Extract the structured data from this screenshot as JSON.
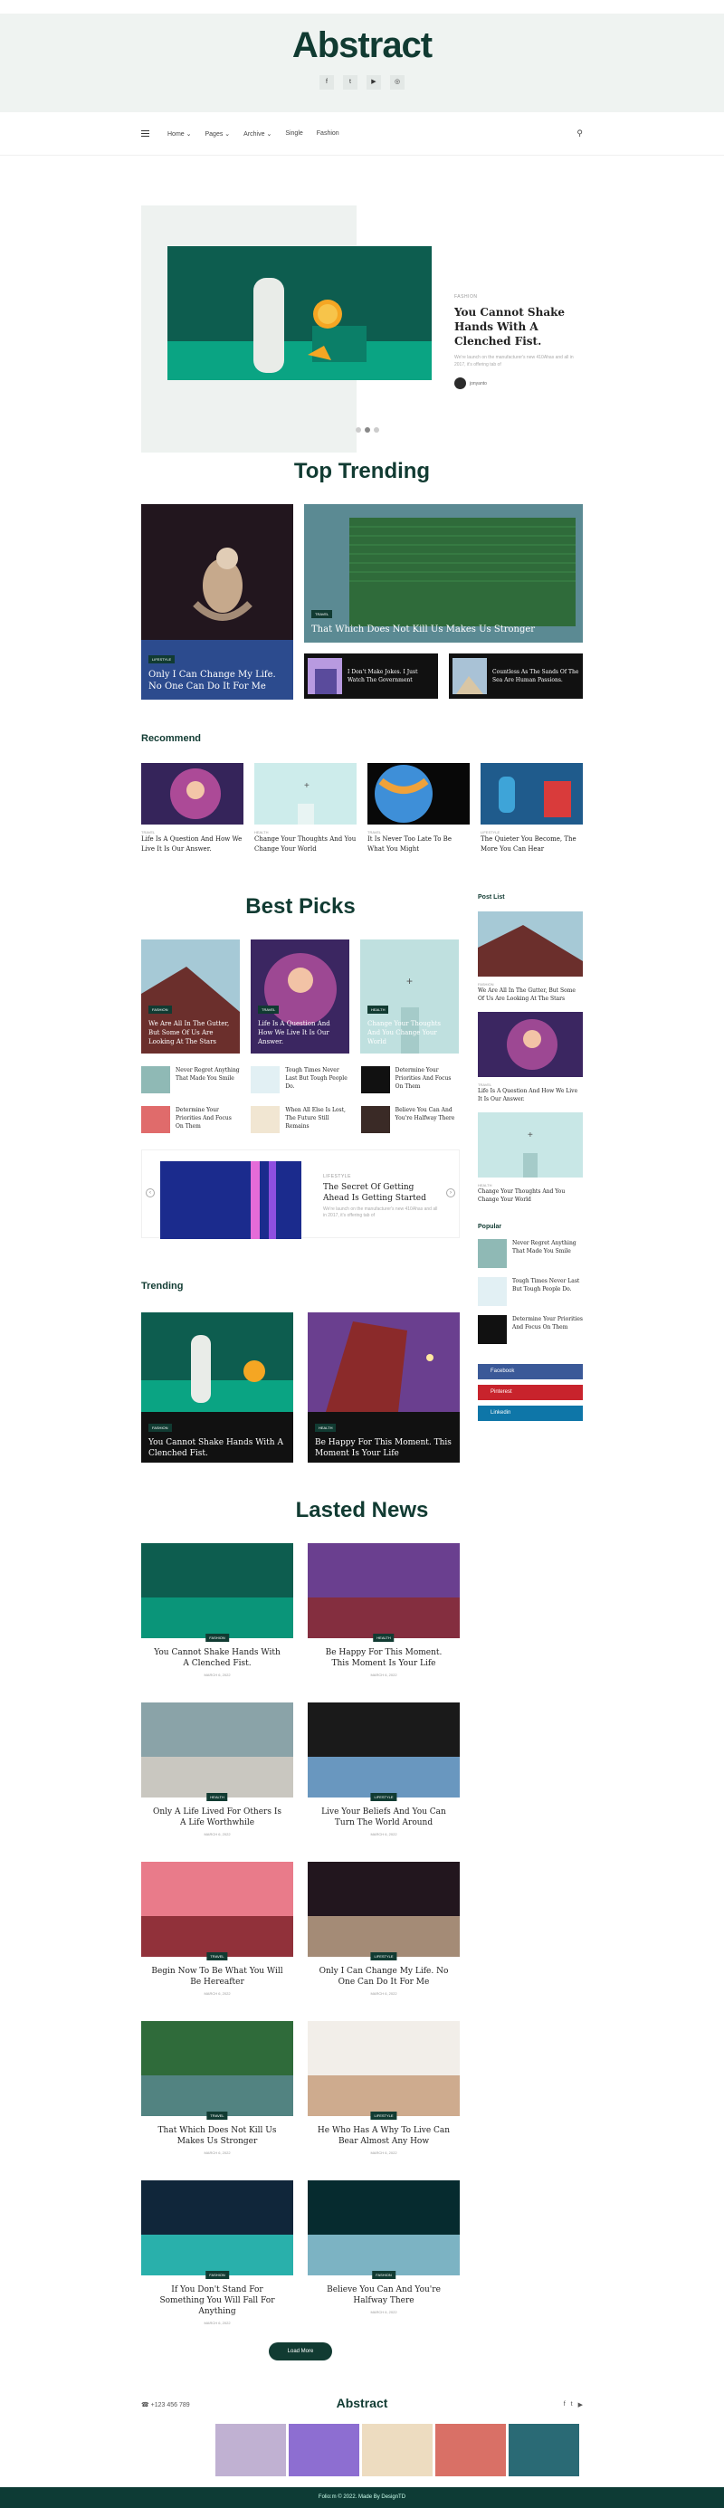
{
  "header": {
    "logo": "Abstract",
    "social": [
      "f",
      "t",
      "▶",
      "◎"
    ]
  },
  "nav": {
    "items": [
      "Home ⌄",
      "Pages ⌄",
      "Archive ⌄",
      "Single",
      "Fashion"
    ]
  },
  "hero": {
    "category": "FASHION",
    "title": "You Cannot Shake Hands With A Clenched Fist.",
    "excerpt": "We're launch on the manufacturer's new 410Ahas and all in 2017, it's offering tab of",
    "author": "jonyanto"
  },
  "trending": {
    "title": "Top Trending",
    "big1": {
      "badge": "LIFESTYLE",
      "title": "Only I Can Change My Life. No One Can Do It For Me"
    },
    "big2": {
      "badge": "TRAVEL",
      "title": "That Which Does Not Kill Us Makes Us Stronger"
    },
    "small": [
      {
        "title": "I Don't Make Jokes. I Just Watch The Government"
      },
      {
        "title": "Countless As The Sands Of The Sea Are Human Passions."
      }
    ]
  },
  "recommend": {
    "title": "Recommend",
    "items": [
      {
        "cat": "TRAVEL",
        "title": "Life Is A Question And How We Live It Is Our Answer."
      },
      {
        "cat": "HEALTH",
        "title": "Change Your Thoughts And You Change Your World"
      },
      {
        "cat": "TRAVEL",
        "title": "It Is Never Too Late To Be What You Might"
      },
      {
        "cat": "LIFESTYLE",
        "title": "The Quieter You Become, The More You Can Hear"
      }
    ]
  },
  "bestpicks": {
    "title": "Best Picks",
    "cards": [
      {
        "badge": "FASHION",
        "title": "We Are All In The Gutter, But Some Of Us Are Looking At The Stars"
      },
      {
        "badge": "TRAVEL",
        "title": "Life Is A Question And How We Live It Is Our Answer."
      },
      {
        "badge": "HEALTH",
        "title": "Change Your Thoughts And You Change Your World"
      }
    ],
    "list": [
      "Never Regret Anything That Made You Smile",
      "Tough Times Never Last But Tough People Do.",
      "Determine Your Priorities And Focus On Them",
      "Determine Your Priorities And Focus On Them",
      "When All Else Is Lost, The Future Still Remains",
      "Believe You Can And You're Halfway There"
    ],
    "slider": {
      "cat": "LIFESTYLE",
      "title": "The Secret Of Getting Ahead Is Getting Started",
      "excerpt": "We're launch on the manufacturer's new 410Ahas and all in 2017, it's offering tab of"
    }
  },
  "sidebar": {
    "post_list": "Post List",
    "posts": [
      {
        "cat": "FASHION",
        "title": "We Are All In The Gutter, But Some Of Us Are Looking At The Stars"
      },
      {
        "cat": "TRAVEL",
        "title": "Life Is A Question And How We Live It Is Our Answer."
      },
      {
        "cat": "HEALTH",
        "title": "Change Your Thoughts And You Change Your World"
      }
    ],
    "popular": "Popular",
    "pop_items": [
      "Never Regret Anything That Made You Smile",
      "Tough Times Never Last But Tough People Do.",
      "Determine Your Priorities And Focus On Them"
    ],
    "share": [
      "Facebook",
      "Pinterest",
      "Linkedin"
    ]
  },
  "trending2": {
    "title": "Trending",
    "cards": [
      {
        "badge": "FASHION",
        "title": "You Cannot Shake Hands With A Clenched Fist.",
        "date": "MARCH 6, 2022"
      },
      {
        "badge": "HEALTH",
        "title": "Be Happy For This Moment. This Moment Is Your Life",
        "date": "MARCH 6, 2022"
      }
    ]
  },
  "latest": {
    "title": "Lasted News",
    "items": [
      {
        "badge": "FASHION",
        "title": "You Cannot Shake Hands With A Clenched Fist.",
        "date": "MARCH 6, 2022"
      },
      {
        "badge": "HEALTH",
        "title": "Be Happy For This Moment. This Moment Is Your Life",
        "date": "MARCH 6, 2022"
      },
      {
        "badge": "HEALTH",
        "title": "Only A Life Lived For Others Is A Life Worthwhile",
        "date": "MARCH 6, 2022"
      },
      {
        "badge": "LIFESTYLE",
        "title": "Live Your Beliefs And You Can Turn The World Around",
        "date": "MARCH 6, 2022"
      },
      {
        "badge": "TRAVEL",
        "title": "Begin Now To Be What You Will Be Hereafter",
        "date": "MARCH 6, 2022"
      },
      {
        "badge": "LIFESTYLE",
        "title": "Only I Can Change My Life. No One Can Do It For Me",
        "date": "MARCH 6, 2022"
      },
      {
        "badge": "TRAVEL",
        "title": "That Which Does Not Kill Us Makes Us Stronger",
        "date": "MARCH 6, 2022"
      },
      {
        "badge": "LIFESTYLE",
        "title": "He Who Has A Why To Live Can Bear Almost Any How",
        "date": "MARCH 6, 2022"
      },
      {
        "badge": "FASHION",
        "title": "If You Don't Stand For Something You Will Fall For Anything",
        "date": "MARCH 6, 2022"
      },
      {
        "badge": "FASHION",
        "title": "Believe You Can And You're Halfway There",
        "date": "MARCH 6, 2022"
      }
    ],
    "load_more": "Load More"
  },
  "footer": {
    "phone": "+123 456 789",
    "logo": "Abstract",
    "copyright": "Folio:m © 2022. Made By DesignTD"
  },
  "colors": {
    "brand": "#113b32"
  }
}
